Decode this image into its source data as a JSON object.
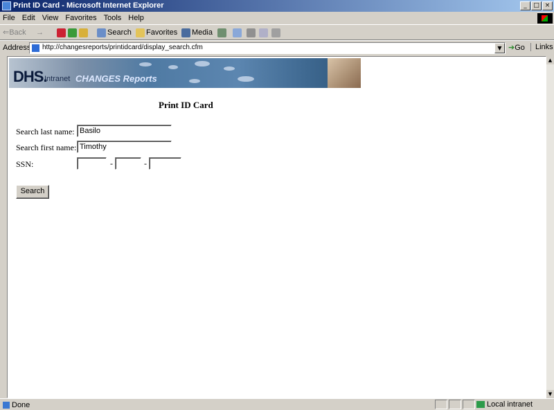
{
  "window": {
    "title": "Print ID Card - Microsoft Internet Explorer",
    "minimize": "_",
    "maximize": "□",
    "close": "×"
  },
  "menu": [
    "File",
    "Edit",
    "View",
    "Favorites",
    "Tools",
    "Help"
  ],
  "toolbar": {
    "back": "⇐Back",
    "forward": "→",
    "search": "Search",
    "favorites": "Favorites",
    "media": "Media"
  },
  "address": {
    "label": "Address",
    "url": "http://changesreports/printidcard/display_search.cfm",
    "go": "Go",
    "links": "Links"
  },
  "banner": {
    "dhs": "DHS.",
    "intranet": "Intranet",
    "changes": "CHANGES Reports"
  },
  "page": {
    "title": "Print ID Card",
    "last_name_label": "Search last name:",
    "last_name_value": "Basilo",
    "first_name_label": "Search first name:",
    "first_name_value": "Timothy",
    "ssn_label": "SSN:",
    "ssn_parts": [
      "",
      "",
      ""
    ],
    "ssn_sep": "-",
    "search_button": "Search"
  },
  "status": {
    "text": "Done",
    "zone": "Local intranet"
  }
}
